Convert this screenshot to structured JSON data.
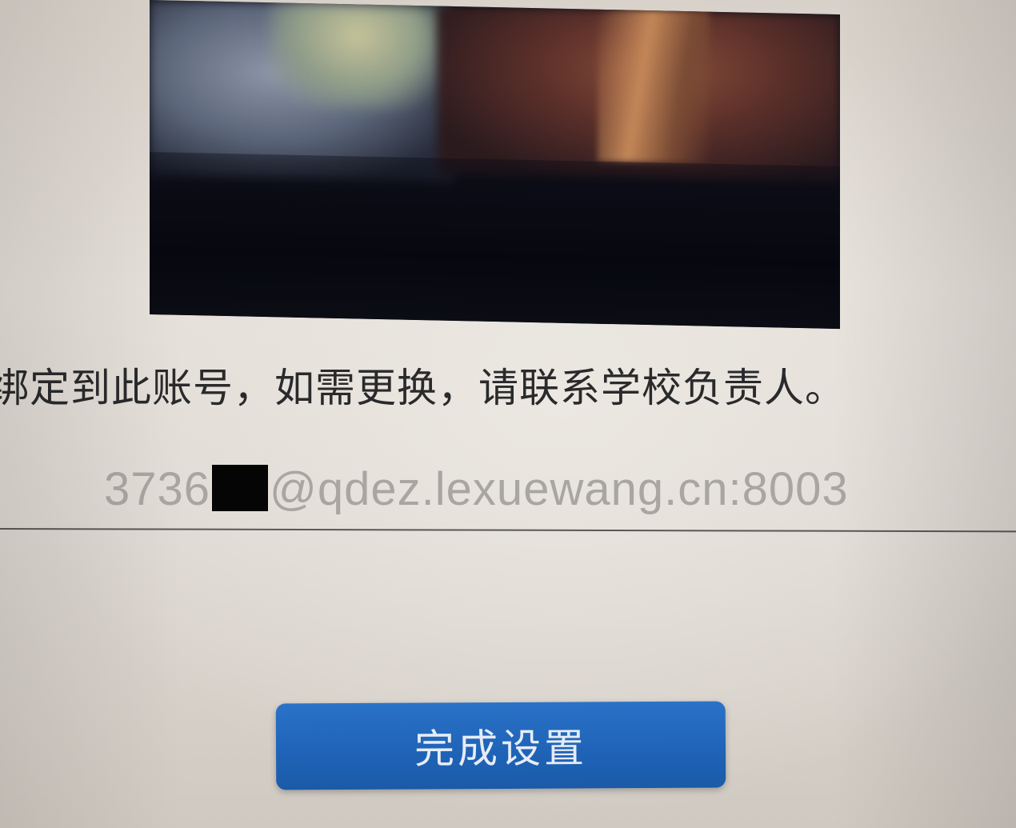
{
  "notice": {
    "text": "绑定到此账号，如需更换，请联系学校负责人。"
  },
  "account": {
    "prefix": "3736",
    "suffix": "@qdez.lexuewang.cn:8003"
  },
  "actions": {
    "finish_label": "完成设置"
  },
  "colors": {
    "button": "#1f64b8",
    "button_text": "#e6ecf6",
    "account_text": "#a9a6a2",
    "notice_text": "#2a2a2c"
  }
}
